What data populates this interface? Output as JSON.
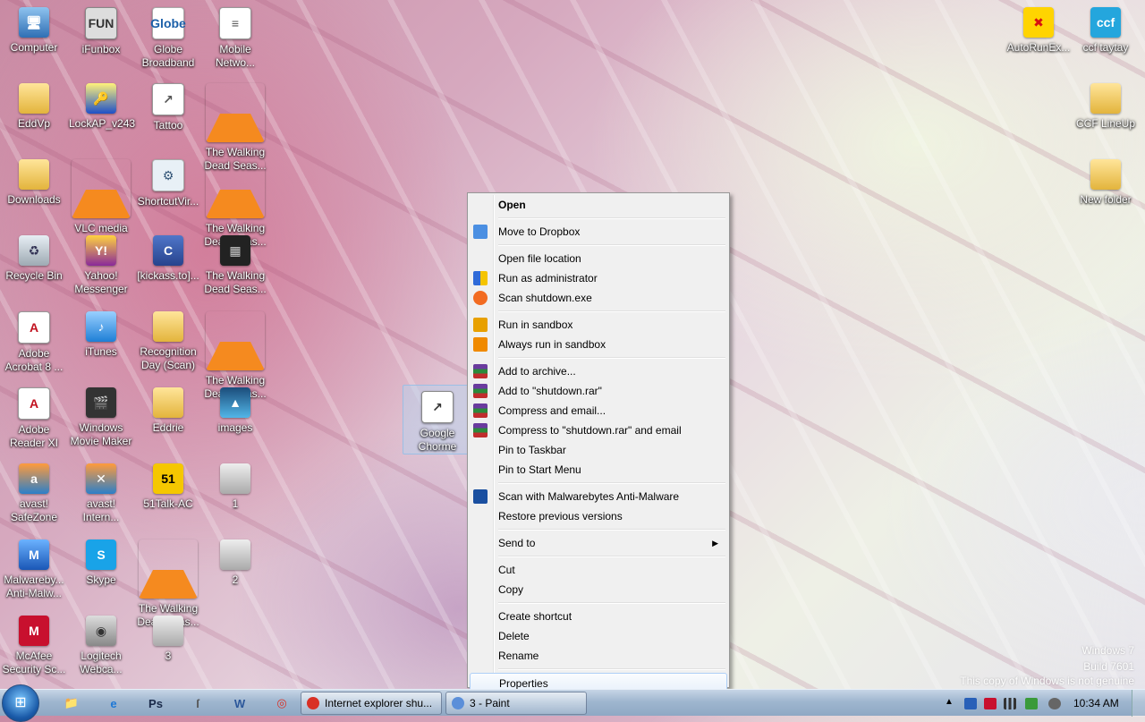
{
  "desktop": {
    "icons": [
      {
        "label": "Computer",
        "glyph": "🖥",
        "icon": "computer-icon"
      },
      {
        "label": "iFunbox",
        "glyph": "FUN",
        "icon": "ifunbox-icon"
      },
      {
        "label": "Globe Broadband",
        "glyph": "Globe",
        "icon": "globe-icon"
      },
      {
        "label": "Mobile Netwo...",
        "glyph": "≡",
        "icon": "document-icon"
      },
      {
        "label": "EddVp",
        "glyph": "",
        "icon": "folder-icon"
      },
      {
        "label": "LockAP_v243",
        "glyph": "🔑",
        "icon": "key-icon"
      },
      {
        "label": "Tattoo",
        "glyph": "↗",
        "icon": "document-icon"
      },
      {
        "label": "The Walking Dead Seas...",
        "glyph": "",
        "icon": "vlc-icon"
      },
      {
        "label": "Downloads",
        "glyph": "",
        "icon": "folder-icon"
      },
      {
        "label": "VLC media player",
        "glyph": "",
        "icon": "vlc-icon"
      },
      {
        "label": "ShortcutVir...",
        "glyph": "⚙",
        "icon": "gear-icon"
      },
      {
        "label": "The Walking Dead Seas...",
        "glyph": "",
        "icon": "vlc-icon"
      },
      {
        "label": "Recycle Bin",
        "glyph": "♻",
        "icon": "recycle-bin-icon"
      },
      {
        "label": "Yahoo! Messenger",
        "glyph": "Y!",
        "icon": "yahoo-icon"
      },
      {
        "label": "[kickass.to]...",
        "glyph": "C",
        "icon": "kickass-icon"
      },
      {
        "label": "The Walking Dead Seas...",
        "glyph": "▦",
        "icon": "film-icon"
      },
      {
        "label": "Adobe Acrobat 8 ...",
        "glyph": "A",
        "icon": "pdf-icon"
      },
      {
        "label": "iTunes",
        "glyph": "♪",
        "icon": "itunes-icon"
      },
      {
        "label": "Recognition Day (Scan)",
        "glyph": "",
        "icon": "folder-icon"
      },
      {
        "label": "The Walking Dead Seas...",
        "glyph": "",
        "icon": "vlc-icon"
      },
      {
        "label": "Adobe Reader XI",
        "glyph": "A",
        "icon": "pdf-icon"
      },
      {
        "label": "Windows Movie Maker",
        "glyph": "🎬",
        "icon": "movie-maker-icon"
      },
      {
        "label": "Eddrie",
        "glyph": "",
        "icon": "folder-icon"
      },
      {
        "label": "images",
        "glyph": "▲",
        "icon": "images-icon"
      },
      {
        "label": "avast! SafeZone",
        "glyph": "a",
        "icon": "avast-icon"
      },
      {
        "label": "avast! Intern...",
        "glyph": "✕",
        "icon": "avast-icon"
      },
      {
        "label": "51Talk-AC",
        "glyph": "51",
        "icon": "51talk-icon"
      },
      {
        "label": "1",
        "glyph": "",
        "icon": "drive-icon"
      },
      {
        "label": "Malwareby... Anti-Malw...",
        "glyph": "M",
        "icon": "malwarebytes-icon"
      },
      {
        "label": "Skype",
        "glyph": "S",
        "icon": "skype-icon"
      },
      {
        "label": "The Walking Dead Seas...",
        "glyph": "",
        "icon": "vlc-icon"
      },
      {
        "label": "2",
        "glyph": "",
        "icon": "drive-icon"
      },
      {
        "label": "McAfee Security Sc...",
        "glyph": "M",
        "icon": "mcafee-icon"
      },
      {
        "label": "Logitech Webca...",
        "glyph": "◉",
        "icon": "webcam-icon"
      },
      {
        "label": "3",
        "glyph": "",
        "icon": "drive-icon"
      },
      {
        "label": "Google Chorme",
        "glyph": "↗",
        "icon": "shortcut-icon"
      },
      {
        "label": "AutoRunEx...",
        "glyph": "✖",
        "icon": "autorun-icon"
      },
      {
        "label": "ccf taytay",
        "glyph": "ccf",
        "icon": "ccf-icon"
      },
      {
        "label": "CCF LineUp",
        "glyph": "",
        "icon": "folder-icon"
      },
      {
        "label": "New folder",
        "glyph": "",
        "icon": "folder-icon"
      }
    ]
  },
  "context_menu": {
    "items": [
      {
        "label": "Open",
        "bold": true,
        "icon": "",
        "type": "item"
      },
      {
        "type": "sep"
      },
      {
        "label": "Move to Dropbox",
        "icon": "dropbox-icon",
        "type": "item"
      },
      {
        "type": "sep"
      },
      {
        "label": "Open file location",
        "icon": "",
        "type": "item"
      },
      {
        "label": "Run as administrator",
        "icon": "uac-shield-icon",
        "type": "item"
      },
      {
        "label": "Scan shutdown.exe",
        "icon": "avast-icon",
        "type": "item"
      },
      {
        "type": "sep"
      },
      {
        "label": "Run in sandbox",
        "icon": "lock-icon",
        "type": "item"
      },
      {
        "label": "Always run in sandbox",
        "icon": "play-icon",
        "type": "item"
      },
      {
        "type": "sep"
      },
      {
        "label": "Add to archive...",
        "icon": "winrar-icon",
        "type": "item"
      },
      {
        "label": "Add to \"shutdown.rar\"",
        "icon": "winrar-icon",
        "type": "item"
      },
      {
        "label": "Compress and email...",
        "icon": "winrar-icon",
        "type": "item"
      },
      {
        "label": "Compress to \"shutdown.rar\" and email",
        "icon": "winrar-icon",
        "type": "item"
      },
      {
        "label": "Pin to Taskbar",
        "icon": "",
        "type": "item"
      },
      {
        "label": "Pin to Start Menu",
        "icon": "",
        "type": "item"
      },
      {
        "type": "sep"
      },
      {
        "label": "Scan with Malwarebytes Anti-Malware",
        "icon": "malwarebytes-icon",
        "type": "item"
      },
      {
        "label": "Restore previous versions",
        "icon": "",
        "type": "item"
      },
      {
        "type": "sep"
      },
      {
        "label": "Send to",
        "icon": "",
        "type": "item",
        "submenu": true
      },
      {
        "type": "sep"
      },
      {
        "label": "Cut",
        "icon": "",
        "type": "item"
      },
      {
        "label": "Copy",
        "icon": "",
        "type": "item"
      },
      {
        "type": "sep"
      },
      {
        "label": "Create shortcut",
        "icon": "",
        "type": "item"
      },
      {
        "label": "Delete",
        "icon": "",
        "type": "item"
      },
      {
        "label": "Rename",
        "icon": "",
        "type": "item"
      },
      {
        "type": "sep"
      },
      {
        "label": "Properties",
        "icon": "",
        "type": "item",
        "hover": true
      }
    ]
  },
  "watermark": {
    "line1": "Windows 7",
    "line2": "Build 7601",
    "line3": "This copy of Windows is not genuine"
  },
  "taskbar": {
    "start_glyph": "⊞",
    "pinned": [
      {
        "name": "explorer",
        "glyph": "📁",
        "color": "#d9a521"
      },
      {
        "name": "internet-explorer",
        "glyph": "e",
        "color": "#1e78d6"
      },
      {
        "name": "photoshop",
        "glyph": "Ps",
        "color": "#1a2a4a"
      },
      {
        "name": "script",
        "glyph": "ſ",
        "color": "#555555"
      },
      {
        "name": "word",
        "glyph": "W",
        "color": "#2b579a"
      },
      {
        "name": "chrome",
        "glyph": "◎",
        "color": "#d93025"
      }
    ],
    "windows": [
      {
        "label": "Internet explorer shu...",
        "icon_color": "#d93025"
      },
      {
        "label": "3 - Paint",
        "icon_color": "#5b8fd9"
      }
    ],
    "clock": "10:34 AM"
  },
  "colors": {
    "menu_bg": "#f0f0f0",
    "menu_hover_border": "#aecff7",
    "taskbar": "#9fb6cf"
  }
}
